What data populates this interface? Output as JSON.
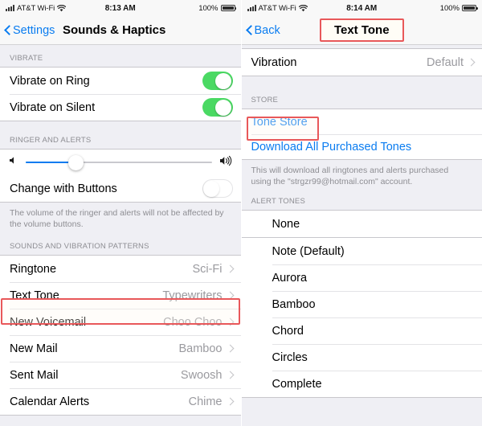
{
  "left_screen": {
    "status_bar": {
      "carrier": "AT&T Wi-Fi",
      "time": "8:13 AM",
      "battery_percent": "100%",
      "signal_icon": "signal-bars-icon",
      "wifi_icon": "wifi-icon",
      "battery_icon": "battery-full-icon"
    },
    "nav": {
      "back_label": "Settings",
      "title": "Sounds & Haptics",
      "back_icon": "chevron-left-icon"
    },
    "vibrate_section": {
      "header": "VIBRATE",
      "rows": [
        {
          "label": "Vibrate on Ring",
          "state": "on"
        },
        {
          "label": "Vibrate on Silent",
          "state": "on"
        }
      ]
    },
    "ringer_section": {
      "header": "RINGER AND ALERTS",
      "slider": {
        "value_percent": 27,
        "low_icon": "speaker-low-icon",
        "high_icon": "speaker-high-icon"
      },
      "change_with_buttons": {
        "label": "Change with Buttons",
        "state": "off"
      },
      "footnote": "The volume of the ringer and alerts will not be affected by the volume buttons."
    },
    "patterns_section": {
      "header": "SOUNDS AND VIBRATION PATTERNS",
      "rows": [
        {
          "label": "Ringtone",
          "value": "Sci-Fi"
        },
        {
          "label": "Text Tone",
          "value": "Typewriters",
          "highlighted": true
        },
        {
          "label": "New Voicemail",
          "value": "Choo Choo"
        },
        {
          "label": "New Mail",
          "value": "Bamboo"
        },
        {
          "label": "Sent Mail",
          "value": "Swoosh"
        },
        {
          "label": "Calendar Alerts",
          "value": "Chime"
        }
      ]
    }
  },
  "right_screen": {
    "status_bar": {
      "carrier": "AT&T Wi-Fi",
      "time": "8:14 AM",
      "battery_percent": "100%",
      "signal_icon": "signal-bars-icon",
      "wifi_icon": "wifi-icon",
      "battery_icon": "battery-full-icon"
    },
    "nav": {
      "back_label": "Back",
      "title": "Text Tone",
      "title_highlighted": true,
      "back_icon": "chevron-left-icon"
    },
    "vibration_row": {
      "label": "Vibration",
      "value": "Default"
    },
    "store_section": {
      "header": "STORE",
      "tone_store_link": "Tone Store",
      "tone_store_highlighted": true,
      "download_all_link": "Download All Purchased Tones",
      "footnote": "This will download all ringtones and alerts purchased using the \"strgzr99@hotmail.com\" account."
    },
    "alert_tones_section": {
      "header": "ALERT TONES",
      "rows": [
        {
          "label": "None"
        },
        {
          "label": "Note (Default)"
        },
        {
          "label": "Aurora"
        },
        {
          "label": "Bamboo"
        },
        {
          "label": "Chord"
        },
        {
          "label": "Circles"
        },
        {
          "label": "Complete"
        }
      ]
    }
  },
  "colors": {
    "accent_blue": "#0a7cf0",
    "switch_green": "#4ad963",
    "highlight_red": "#e8585a",
    "group_bg": "#efeff4"
  }
}
